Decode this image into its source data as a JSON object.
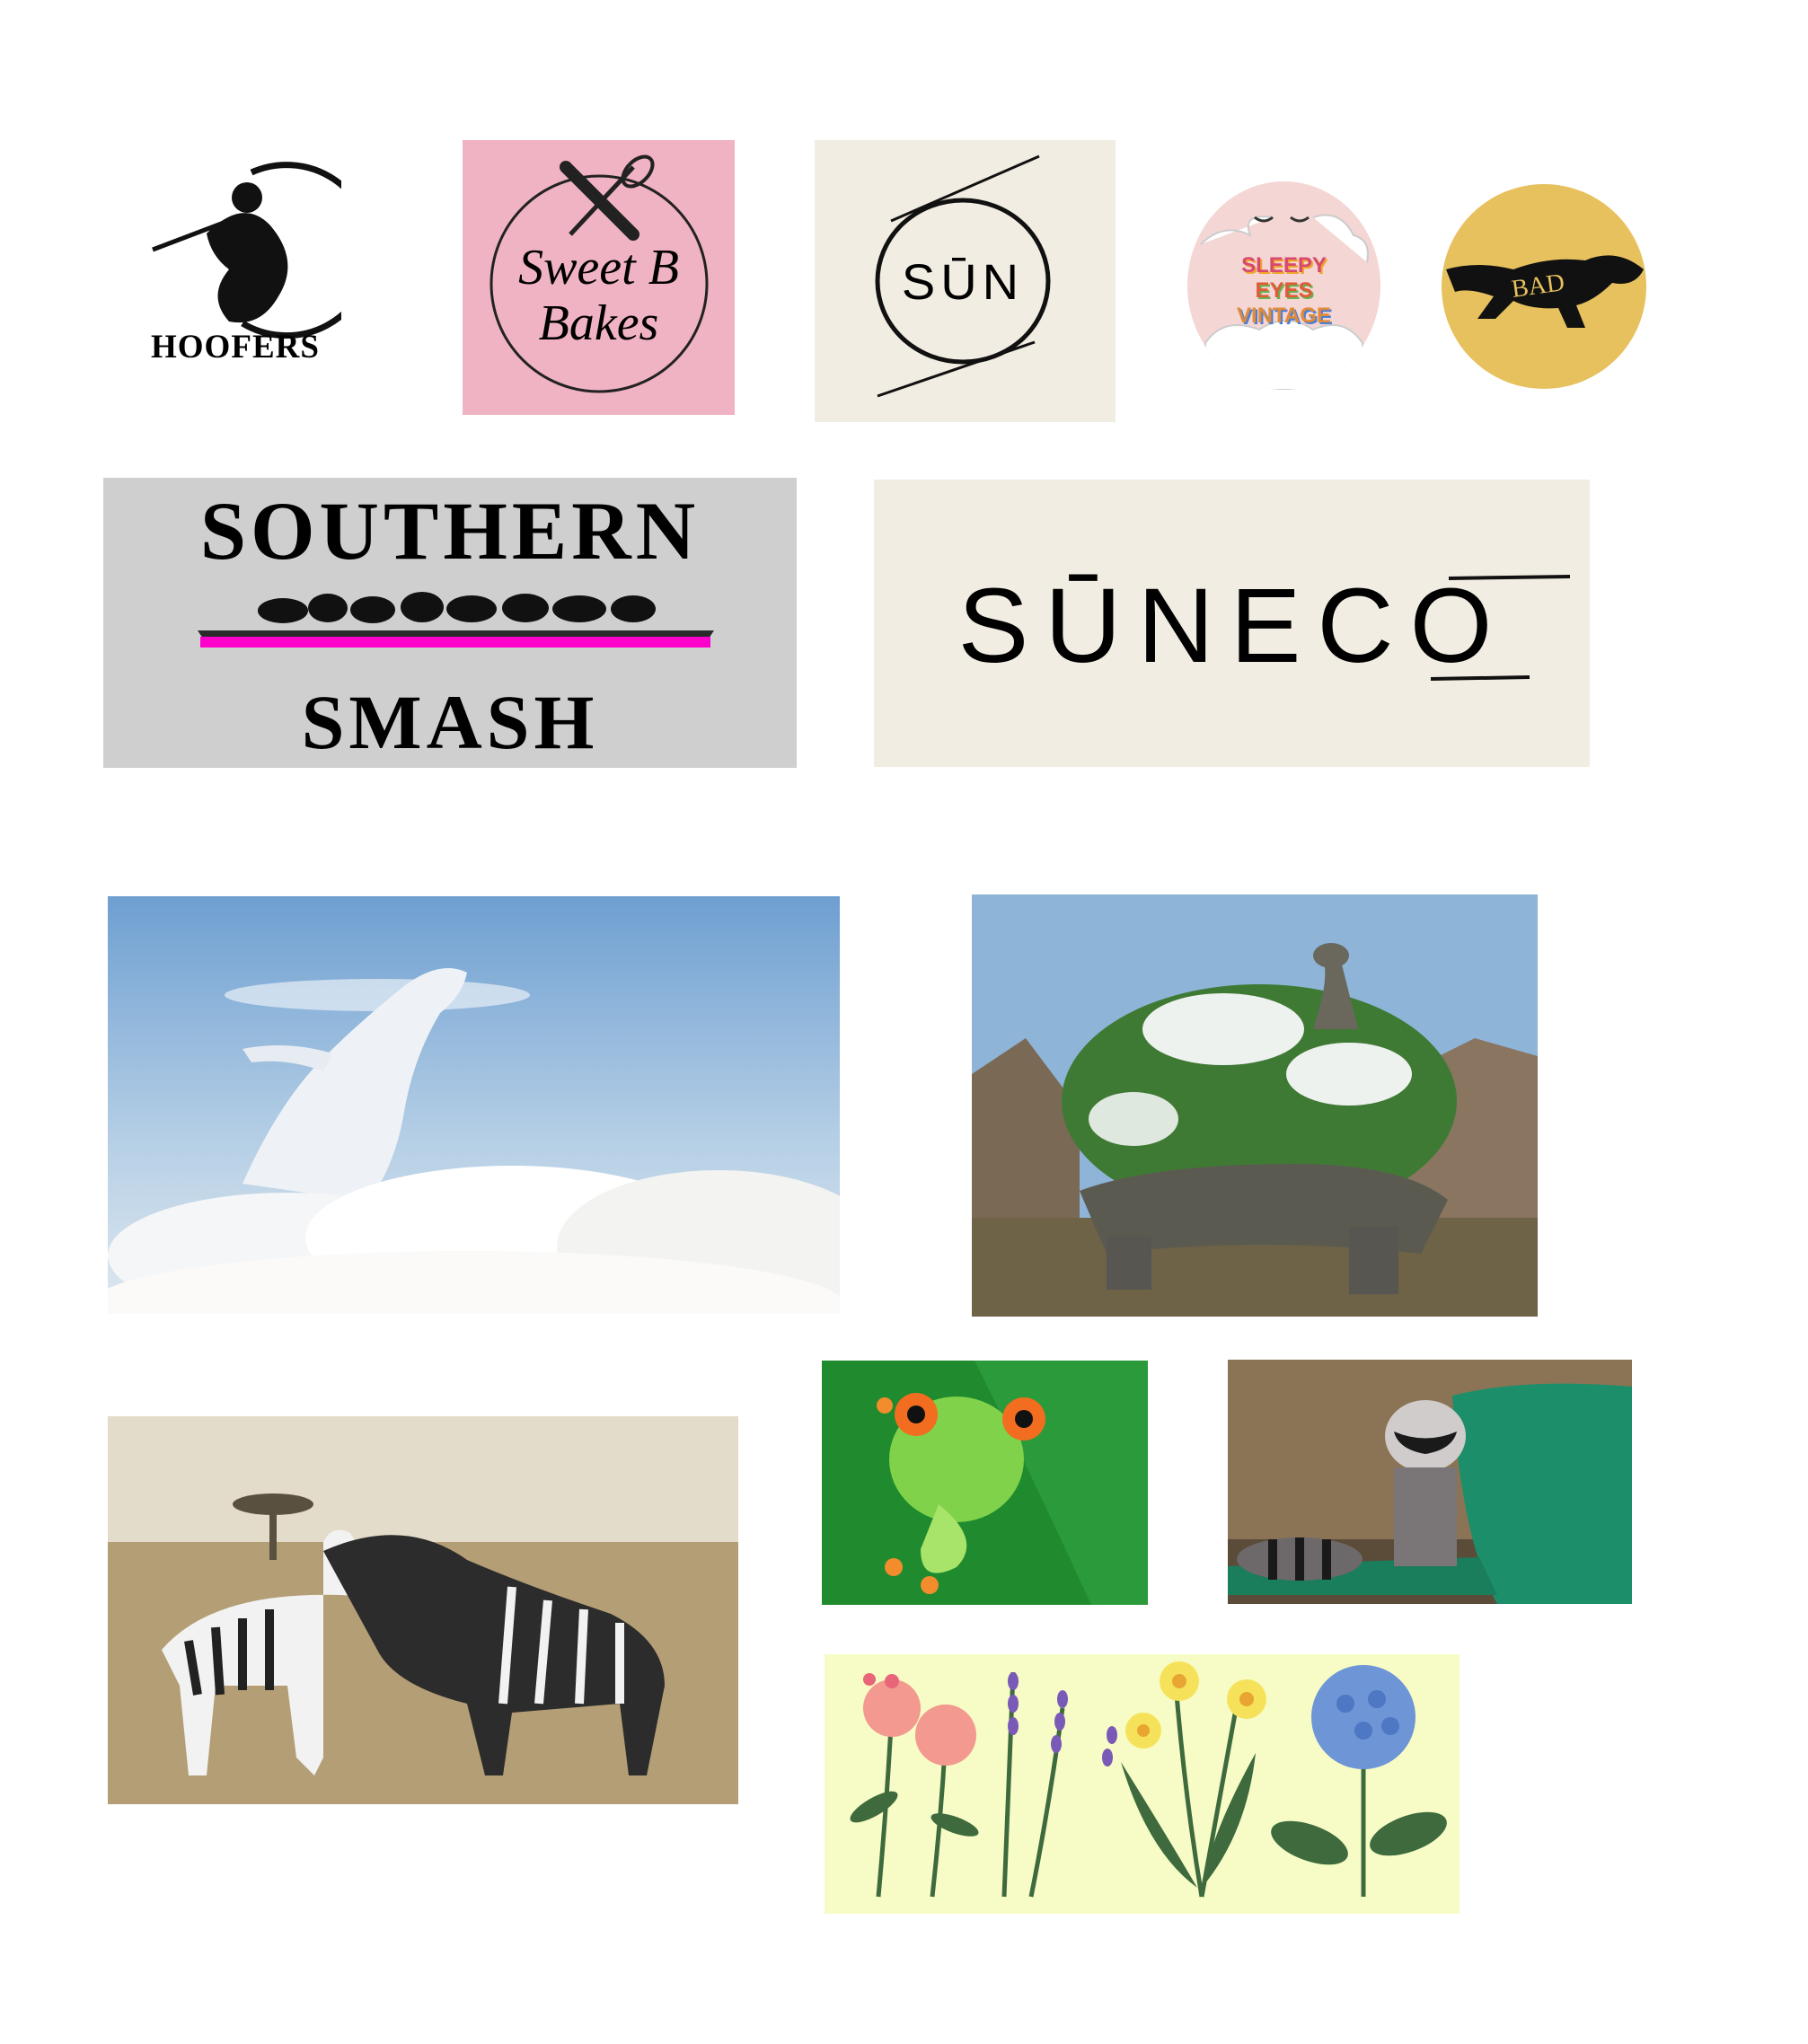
{
  "logos": {
    "hoofers": {
      "text": "HOOFERS"
    },
    "sweet_b": {
      "line1": "Sweet B",
      "line2": "Bakes",
      "bg": "#f0b3c3"
    },
    "sun": {
      "text": "SŪN",
      "bg": "#f2ede2"
    },
    "sleepy": {
      "line1": "SLEEPY",
      "line2": "EYES",
      "line3": "VINTAGE"
    },
    "bad": {
      "text": "BAD",
      "bg": "#e6c15e"
    },
    "southern": {
      "line1": "SOUTHERN",
      "line2": "SMASH",
      "accent": "#ff00cc"
    },
    "suneco": {
      "text": "SŪNECO",
      "bg": "#f2ede2"
    }
  },
  "illustrations": {
    "whale": "cloud-whale-image",
    "tortoise": "forest-tortoise-image",
    "zebras": "zebras-image",
    "frog": "tree-frog-image",
    "raccoon": "raccoon-trashcan-image",
    "flowers": "flowers-illustration"
  }
}
